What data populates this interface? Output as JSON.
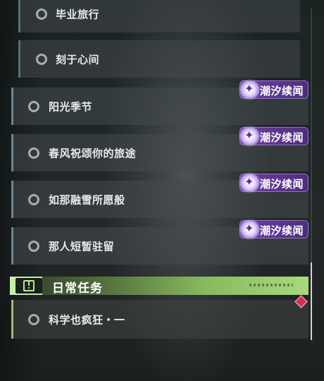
{
  "quests": [
    {
      "label": "毕业旅行"
    },
    {
      "label": "刻于心间"
    },
    {
      "label": "阳光季节",
      "badge": "潮汐续闻"
    },
    {
      "label": "春风祝颂你的旅途",
      "badge": "潮汐续闻"
    },
    {
      "label": "如那融雪所愿般",
      "badge": "潮汐续闻"
    },
    {
      "label": "那人短暂驻留",
      "badge": "潮汐续闻"
    }
  ],
  "daily_section": {
    "title": "日常任务",
    "icon": "exclamation-icon",
    "items": [
      {
        "label": "科学也疯狂・一",
        "marker": "red-diamond-icon"
      }
    ]
  },
  "colors": {
    "badge_purple": "#6a3fa0",
    "section_green": "#a9e27f",
    "alert_red": "#d83048"
  }
}
